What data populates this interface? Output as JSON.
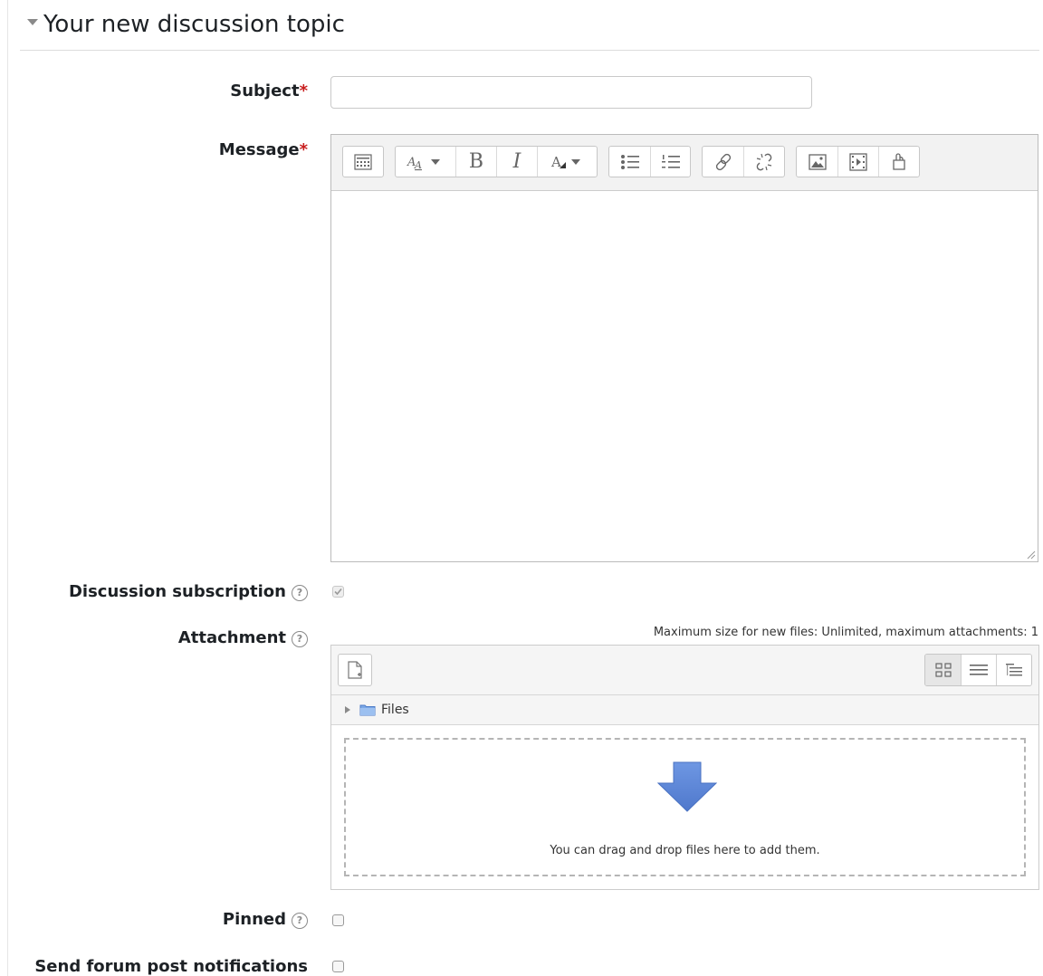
{
  "section": {
    "title": "Your new discussion topic"
  },
  "fields": {
    "subject": {
      "label": "Subject",
      "required_mark": "*",
      "value": ""
    },
    "message": {
      "label": "Message",
      "required_mark": "*"
    },
    "discussion_subscription": {
      "label": "Discussion subscription",
      "checked": true,
      "disabled": true
    },
    "attachment": {
      "label": "Attachment",
      "info": "Maximum size for new files: Unlimited, maximum attachments: 1"
    },
    "pinned": {
      "label": "Pinned",
      "checked": false
    },
    "send_notifications": {
      "label": "Send forum post notifications",
      "checked": false
    }
  },
  "editor_toolbar": {
    "groups": [
      [
        "toolbar-toggle-icon"
      ],
      [
        "font-style-icon",
        "bold-icon",
        "italic-icon",
        "font-color-icon"
      ],
      [
        "unordered-list-icon",
        "ordered-list-icon"
      ],
      [
        "link-icon",
        "unlink-icon"
      ],
      [
        "image-icon",
        "media-icon",
        "manage-files-icon"
      ]
    ],
    "bold_glyph": "B",
    "italic_glyph": "I"
  },
  "filepicker": {
    "path_label": "Files",
    "drop_message": "You can drag and drop files here to add them.",
    "views": [
      "icons-view-icon",
      "list-view-icon",
      "tree-view-icon"
    ],
    "arrow_color": "#5b86d9"
  },
  "help_glyph": "?"
}
